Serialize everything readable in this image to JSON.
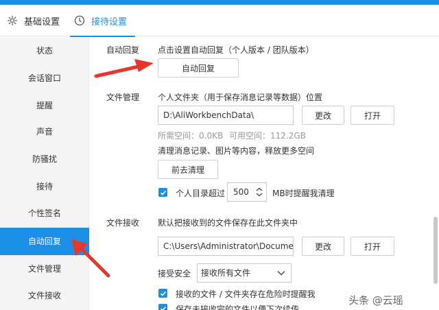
{
  "header": {
    "tabs": [
      {
        "label": "基础设置",
        "icon": "gear-icon"
      },
      {
        "label": "接待设置",
        "icon": "clock-icon"
      }
    ]
  },
  "sidebar": {
    "items": [
      {
        "label": "状态"
      },
      {
        "label": "会话窗口"
      },
      {
        "label": "提醒"
      },
      {
        "label": "声音"
      },
      {
        "label": "防骚扰"
      },
      {
        "label": "接待"
      },
      {
        "label": "个性签名"
      },
      {
        "label": "自动回复"
      },
      {
        "label": "文件管理"
      },
      {
        "label": "文件接收"
      }
    ],
    "active": "自动回复"
  },
  "auto_reply": {
    "label": "自动回复",
    "description": "点击设置自动回复（个人版本 / 团队版本）",
    "button": "自动回复"
  },
  "file_management": {
    "label": "文件管理",
    "folder_desc": "个人文件夹（用于保存消息记录等数据）位置",
    "path": "D:\\AliWorkbenchData\\",
    "change_button": "更改",
    "open_button": "打开",
    "required_space": "所需空间：0.0KB",
    "available_space": "可用空间：112.2GB",
    "clean_desc": "清理消息记录、图片等内容，释放更多空间",
    "clean_button": "前去清理",
    "threshold_prefix": "个人目录超过",
    "threshold_value": "500",
    "threshold_suffix": "MB时提醒我清理"
  },
  "file_receive": {
    "label": "文件接收",
    "desc": "默认把接收到的文件保存在此文件夹中",
    "path": "C:\\Users\\Administrator\\Docume",
    "change_button": "更改",
    "open_button": "打开",
    "security_label": "接受安全",
    "security_option": "接收所有文件",
    "danger_warning": "接收的文件 / 文件夹存在危险时提醒我",
    "partial_row": "保存未接收完的文件以便下次续传"
  },
  "watermark": "头条 @云瑶",
  "colors": {
    "accent": "#1a8fe5",
    "arrow": "#e8372a"
  }
}
